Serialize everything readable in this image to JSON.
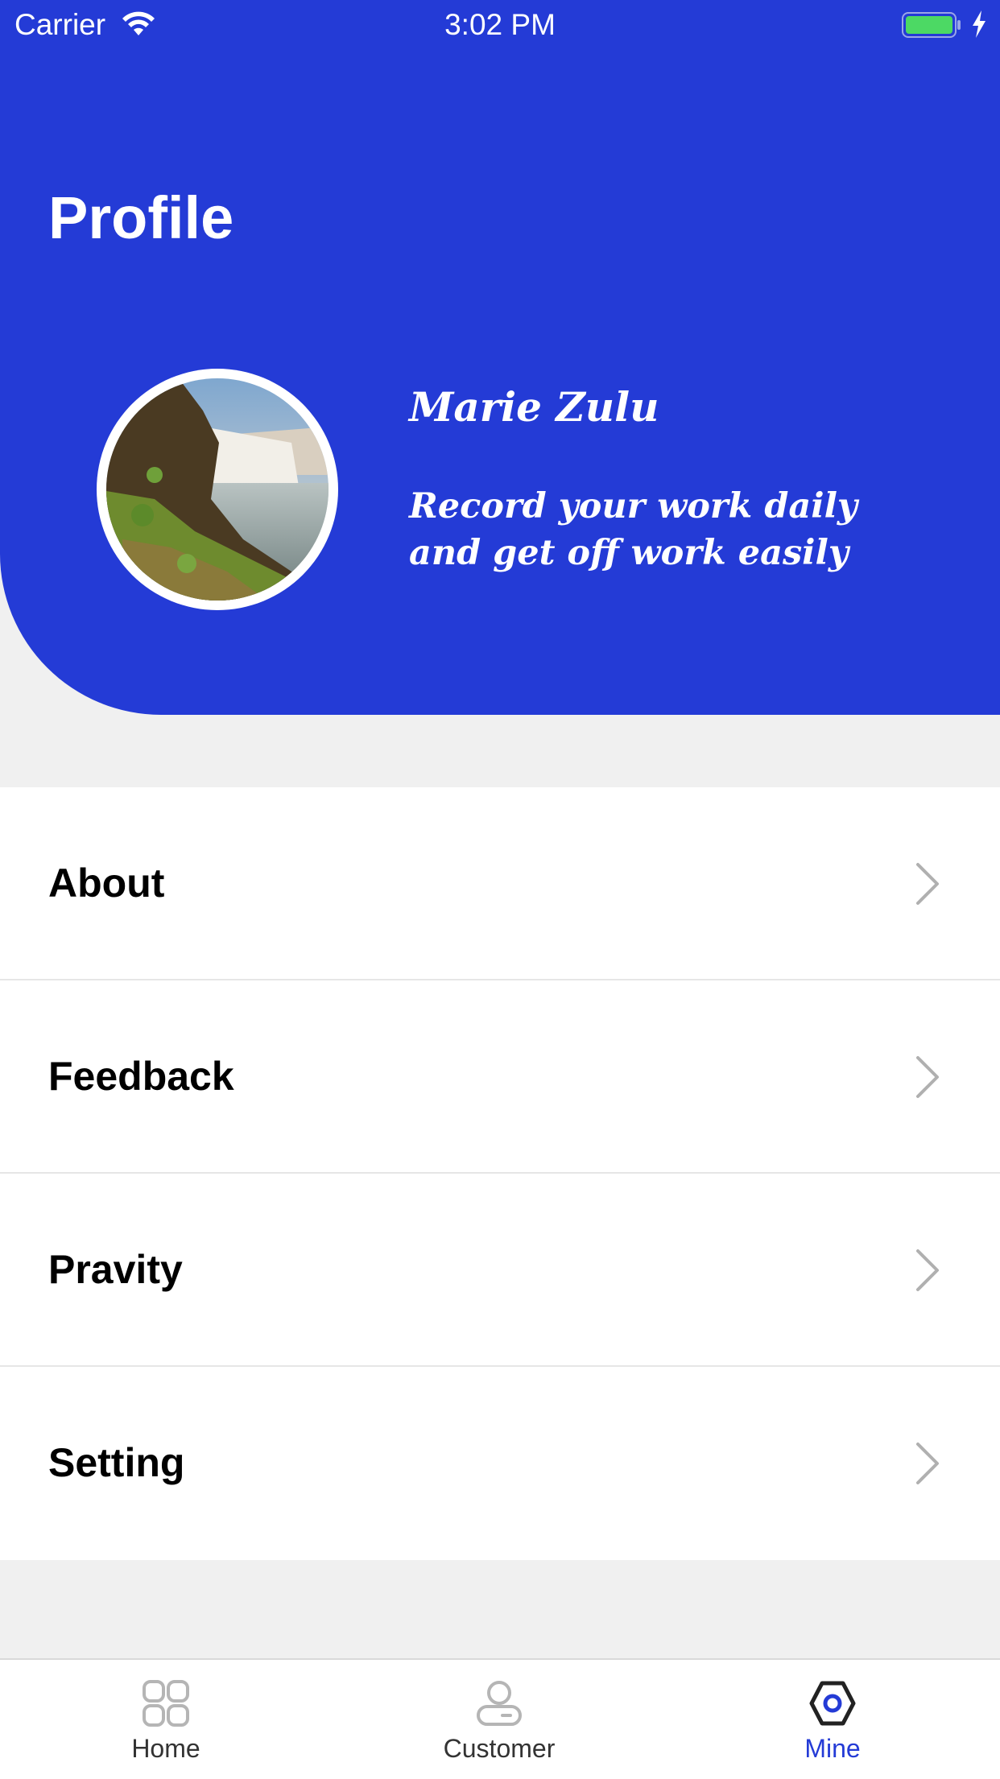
{
  "status_bar": {
    "carrier": "Carrier",
    "time": "3:02 PM"
  },
  "header": {
    "title": "Profile",
    "accent_color": "#243bd6"
  },
  "profile": {
    "name": "Marie Zulu",
    "motto": "Record your work daily and get off work easily"
  },
  "menu": {
    "items": [
      {
        "label": "About"
      },
      {
        "label": "Feedback"
      },
      {
        "label": "Pravity"
      },
      {
        "label": "Setting"
      }
    ]
  },
  "tabbar": {
    "tabs": [
      {
        "label": "Home",
        "icon": "grid-icon"
      },
      {
        "label": "Customer",
        "icon": "person-icon"
      },
      {
        "label": "Mine",
        "icon": "hexagon-icon",
        "active": true
      }
    ]
  }
}
